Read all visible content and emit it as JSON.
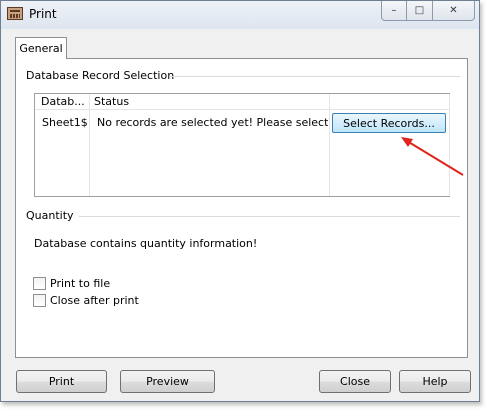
{
  "window": {
    "title": "Print",
    "controls": {
      "minimize": "–",
      "maximize": "□",
      "close": "✕"
    }
  },
  "tabs": [
    {
      "label": "General"
    }
  ],
  "database_section": {
    "title": "Database Record Selection",
    "columns": [
      "Datab...",
      "Status",
      ""
    ],
    "rows": [
      {
        "database": "Sheet1$",
        "status": "No records are selected yet! Please select r...",
        "action": "Select Records..."
      }
    ]
  },
  "quantity_section": {
    "title": "Quantity",
    "info": "Database contains quantity information!"
  },
  "options": {
    "print_to_file": {
      "label": "Print to file",
      "checked": false
    },
    "close_after_print": {
      "label": "Close after print",
      "checked": false
    }
  },
  "buttons": {
    "print": "Print",
    "preview": "Preview",
    "close": "Close",
    "help": "Help"
  },
  "annotation": {
    "arrow_color": "#e0241b"
  }
}
